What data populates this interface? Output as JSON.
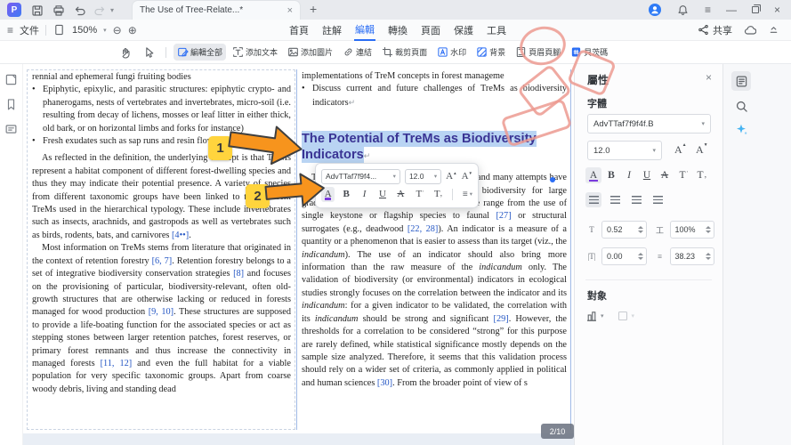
{
  "titlebar": {
    "logo_letter": "P",
    "tab_title": "The Use of Tree-Relate...*",
    "tab_close": "×",
    "new_tab": "+"
  },
  "menubar": {
    "file_label": "文件",
    "zoom_level": "150%",
    "menus": [
      "首頁",
      "註解",
      "編輯",
      "轉換",
      "頁面",
      "保護",
      "工具"
    ],
    "active_menu": "編輯",
    "share_label": "共享"
  },
  "toolbar": {
    "buttons": [
      {
        "label": "編輯全部",
        "icon": "edit-all",
        "active": true
      },
      {
        "label": "添加文本",
        "icon": "add-text",
        "active": false
      },
      {
        "label": "添加圖片",
        "icon": "add-image",
        "active": false
      },
      {
        "label": "連結",
        "icon": "link",
        "active": false
      },
      {
        "label": "裁剪頁面",
        "icon": "crop-page",
        "active": false
      },
      {
        "label": "水印",
        "icon": "watermark",
        "active": false
      },
      {
        "label": "背景",
        "icon": "background",
        "active": false
      },
      {
        "label": "頁眉頁腳",
        "icon": "header-footer",
        "active": false
      },
      {
        "label": "貝茨碼",
        "icon": "bates-number",
        "active": false
      }
    ]
  },
  "document": {
    "left_column": {
      "intro_line": "rennial and ephemeral fungi fruiting bodies",
      "bullets": [
        "Epiphytic, epixylic, and parasitic structures: epiphytic crypto- and phanerogams, nests of vertebrates and invertebrates, micro-soil (i.e. resulting from decay of lichens, mosses or leaf litter in either thick, old bark, or on horizontal limbs and forks for instance)",
        "Fresh exudates such as sap runs and resin flows"
      ],
      "paragraphs": [
        "As reflected in the definition, the underlying concept is that TreMs represent a habitat component of different forest-dwelling species and thus they may indicate their potential presence. A variety of species from different taxonomic groups have been linked to the different TreMs used in the hierarchical typology. These include invertebrates such as insects, arachnids, and gastropods as well as vertebrates such as birds, rodents, bats, and carnivores [4••].",
        "Most information on TreMs stems from literature that originated in the context of retention forestry [6, 7]. Retention forestry belongs to a set of integrative biodiversity conservation strategies [8] and focuses on the provisioning of particular, biodiversity-relevant, often old-growth structures that are otherwise lacking or reduced in forests managed for wood production [9, 10]. These structures are supposed to provide a life-boating function for the associated species or act as stepping stones between larger retention patches, forest reserves, or primary forest remnants and thus increase the connectivity in managed forests [11, 12] and even the full habitat for a viable population for very specific taxonomic groups. Apart from coarse woody debris, living and standing dead"
      ]
    },
    "right_column": {
      "intro_line": "implementations of TreM concepts in forest manageme",
      "bullets": [
        "Discuss current and future challenges of TreMs as biodiversity indicators"
      ],
      "heading": "The Potential of TreMs as Biodiversity Indicators",
      "paragraphs": [
        "There is a large demand for such indicators, and many attempts have been made to develop indicators of forest biodiversity for large gradients of spatial and temporal scales. These range from the use of single keystone or flagship species to faunal [27] or structural surrogates (e.g., deadwood [22, 28]). An indicator is a measure of a quantity or a phenomenon that is easier to assess than its target (viz., the *indicandum*). The use of an indicator should also bring more information than the raw measure of the *indicandum* only. The validation of biodiversity (or environmental) indicators in ecological studies strongly focuses on the correlation between the indicator and its *indicandum*: for a given indicator to be validated, the correlation with its *indicandum* should be strong and significant [29]. However, the thresholds for a correlation to be considered “strong” for this purpose are rarely defined, while statistical significance mostly depends on the sample size analyzed. Therefore, it seems that this validation process should rely on a wider set of criteria, as commonly applied in political and human sciences [30]. From the broader point of view of s"
      ]
    },
    "page_badge": "2/10",
    "return_mark": "↵"
  },
  "floating_toolbar": {
    "font_name": "AdvTTaf7f9f4...",
    "font_size": "12.0",
    "format_buttons": [
      {
        "glyph": "A",
        "name": "font-color",
        "active": true
      },
      {
        "glyph": "B",
        "name": "bold",
        "active": false
      },
      {
        "glyph": "I",
        "name": "italic",
        "active": false
      },
      {
        "glyph": "U",
        "name": "underline",
        "active": false
      },
      {
        "glyph": "A",
        "name": "strikethrough",
        "active": false
      },
      {
        "glyph": "T",
        "name": "superscript",
        "active": false
      },
      {
        "glyph": "T",
        "name": "subscript",
        "active": false
      }
    ]
  },
  "panel": {
    "title": "屬性",
    "close": "×",
    "font_section": "字體",
    "font_name": "AdvTTaf7f9f4f.B",
    "font_size": "12.0",
    "spinners": [
      {
        "icon": "char-spacing",
        "value": "0.52"
      },
      {
        "icon": "horizontal-scale",
        "value": "100%"
      },
      {
        "icon": "word-spacing",
        "value": "0.00"
      },
      {
        "icon": "line-spacing",
        "value": "38.23"
      }
    ],
    "object_section": "對象"
  },
  "tutorial": {
    "step1": "1",
    "step2": "2"
  },
  "colors": {
    "accent": "#2a6df5",
    "heading_text": "#3a3494",
    "selection": "#b9d4f3",
    "arrow_fill": "#f7941d",
    "chip_bg": "#ffd43d",
    "annotation_pink": "#ec9a90",
    "ref_blue": "#2456c4"
  }
}
